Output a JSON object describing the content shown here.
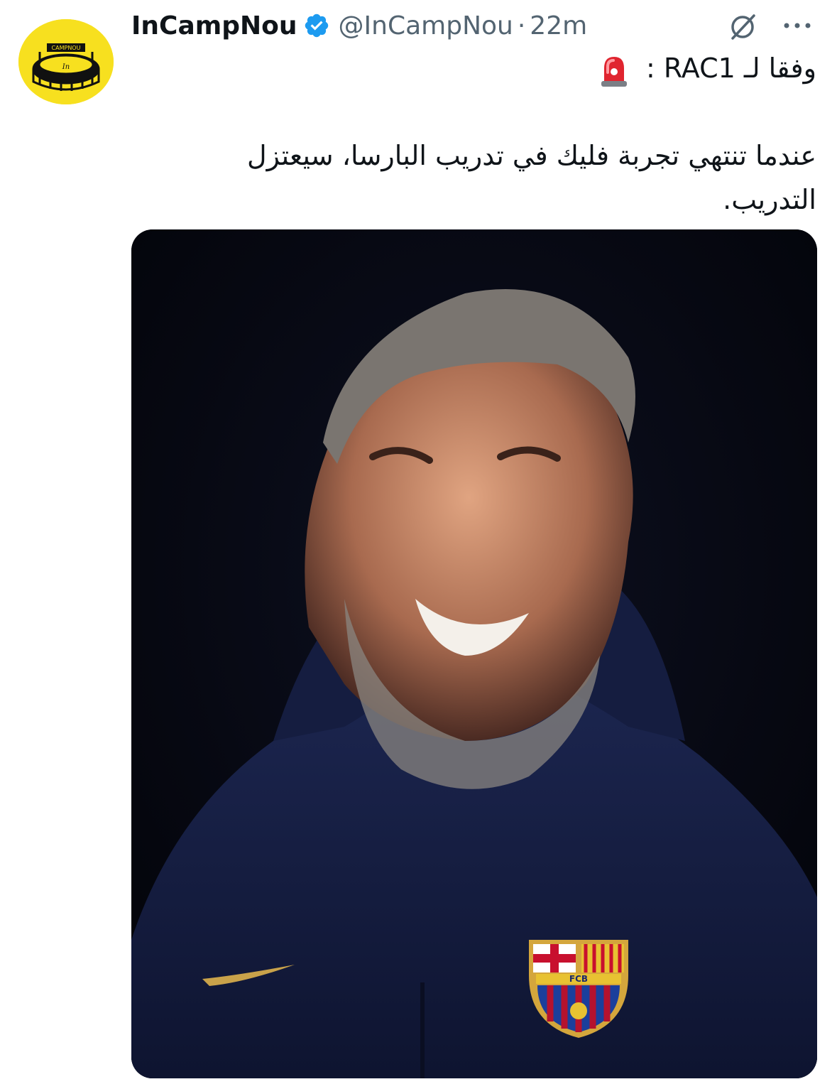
{
  "tweet": {
    "author": {
      "display_name": "InCampNou",
      "handle": "@InCampNou",
      "verified": true,
      "avatar_icon": "stadium-logo-icon",
      "avatar_text": "CAMPNOU",
      "avatar_color": "#f7e01f"
    },
    "separator": "·",
    "timestamp": "22m",
    "header_icons": [
      "grok-icon",
      "more-icon"
    ],
    "line1": "وفقا لـ RAC1 :",
    "line1_icon": "siren-emoji-icon",
    "body": "عندما تنتهي تجربة فليك في تدريب البارسا، سيعتزل التدريب.",
    "media": {
      "alt_icon": "coach-portrait-photo",
      "crest_text": "FCB",
      "background_color": "#05060c"
    },
    "colors": {
      "accent": "#1d9bf0",
      "text": "#0f1419",
      "secondary": "#536471"
    }
  }
}
